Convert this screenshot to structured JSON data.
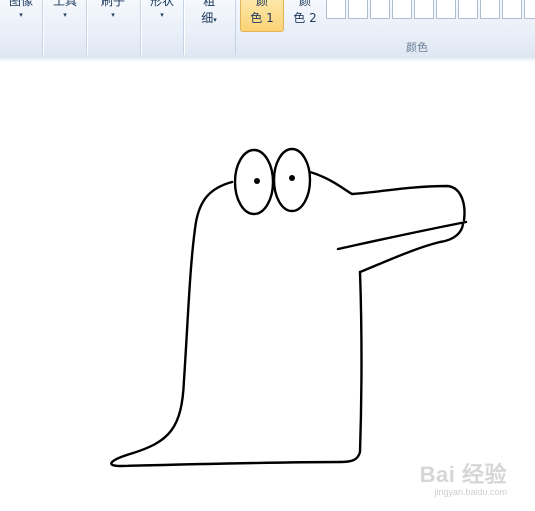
{
  "ribbon": {
    "groups": [
      {
        "label": "图像",
        "arrow": "▾"
      },
      {
        "label": "工具",
        "arrow": "▾"
      },
      {
        "label": "刷子",
        "arrow": "▾"
      },
      {
        "label": "形状",
        "arrow": "▾"
      },
      {
        "label": "粗",
        "label2": "细",
        "arrow": "▾"
      }
    ],
    "color1": {
      "line1": "颜",
      "line2": "色 1",
      "selected": true
    },
    "color2": {
      "line1": "颜",
      "line2": "色 2"
    },
    "colors_group_label": "颜色",
    "accent_color": "#fbd276"
  },
  "canvas": {
    "background": "#ffffff",
    "drawing_subject": "line drawing of a cartoon crocodile-like creature",
    "stroke_color": "#000000"
  },
  "watermark": {
    "logo": "Bai 经验",
    "url": "jingyan.baidu.com"
  }
}
